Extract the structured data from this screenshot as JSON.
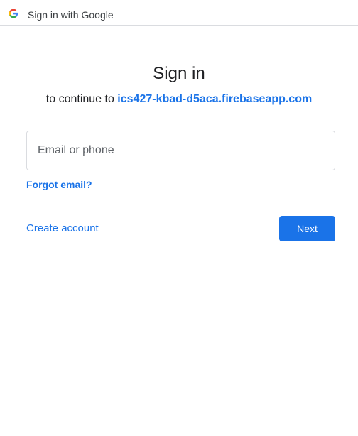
{
  "window": {
    "title": "Sign in with Google",
    "logo_icon": "google-g-icon"
  },
  "main": {
    "heading": "Sign in",
    "subtitle_prefix": "to continue to ",
    "app_domain": "ics427-kbad-d5aca.firebaseapp.com"
  },
  "form": {
    "email_placeholder": "Email or phone",
    "email_value": "",
    "forgot_email_label": "Forgot email?",
    "create_account_label": "Create account",
    "next_label": "Next"
  },
  "colors": {
    "accent": "#1a73e8",
    "border": "#dadce0",
    "text": "#202124",
    "google_blue": "#4285f4",
    "google_red": "#ea4335",
    "google_yellow": "#fbbc05",
    "google_green": "#34a853"
  }
}
